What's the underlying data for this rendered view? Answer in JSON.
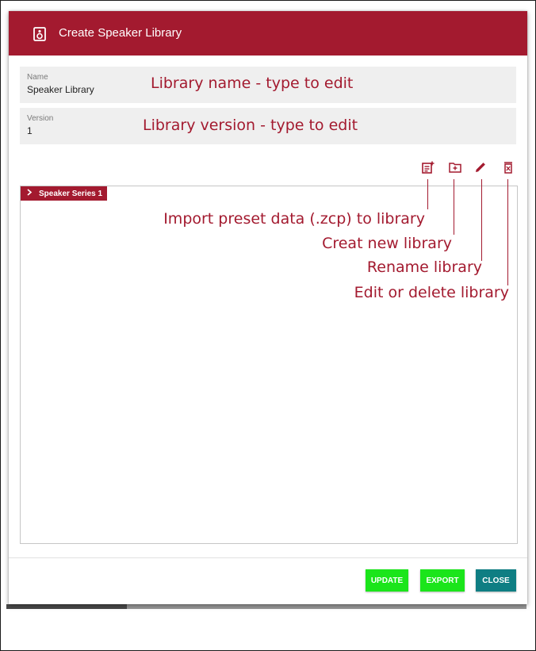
{
  "dialog": {
    "title": "Create Speaker Library",
    "icon": "speaker-icon",
    "header_color": "#a31a2f"
  },
  "fields": {
    "name": {
      "label": "Name",
      "value": "Speaker Library"
    },
    "version": {
      "label": "Version",
      "value": "1"
    }
  },
  "toolbar": {
    "icons": [
      "import-preset-icon",
      "new-folder-icon",
      "pencil-icon",
      "delete-box-icon"
    ]
  },
  "tree": {
    "nodes": [
      {
        "label": "Speaker Series 1",
        "icon": "chevron-right-icon"
      }
    ]
  },
  "annotations": {
    "name": "Library name - type to edit",
    "version": "Library version - type to edit",
    "import": "Import preset data (.zcp) to library",
    "new": "Creat new library",
    "rename": "Rename library",
    "edit_delete": "Edit or delete library",
    "color": "#a31a2f"
  },
  "buttons": {
    "update": "UPDATE",
    "export": "EXPORT",
    "close": "CLOSE",
    "green": "#1be51b",
    "teal": "#0f7e83"
  }
}
